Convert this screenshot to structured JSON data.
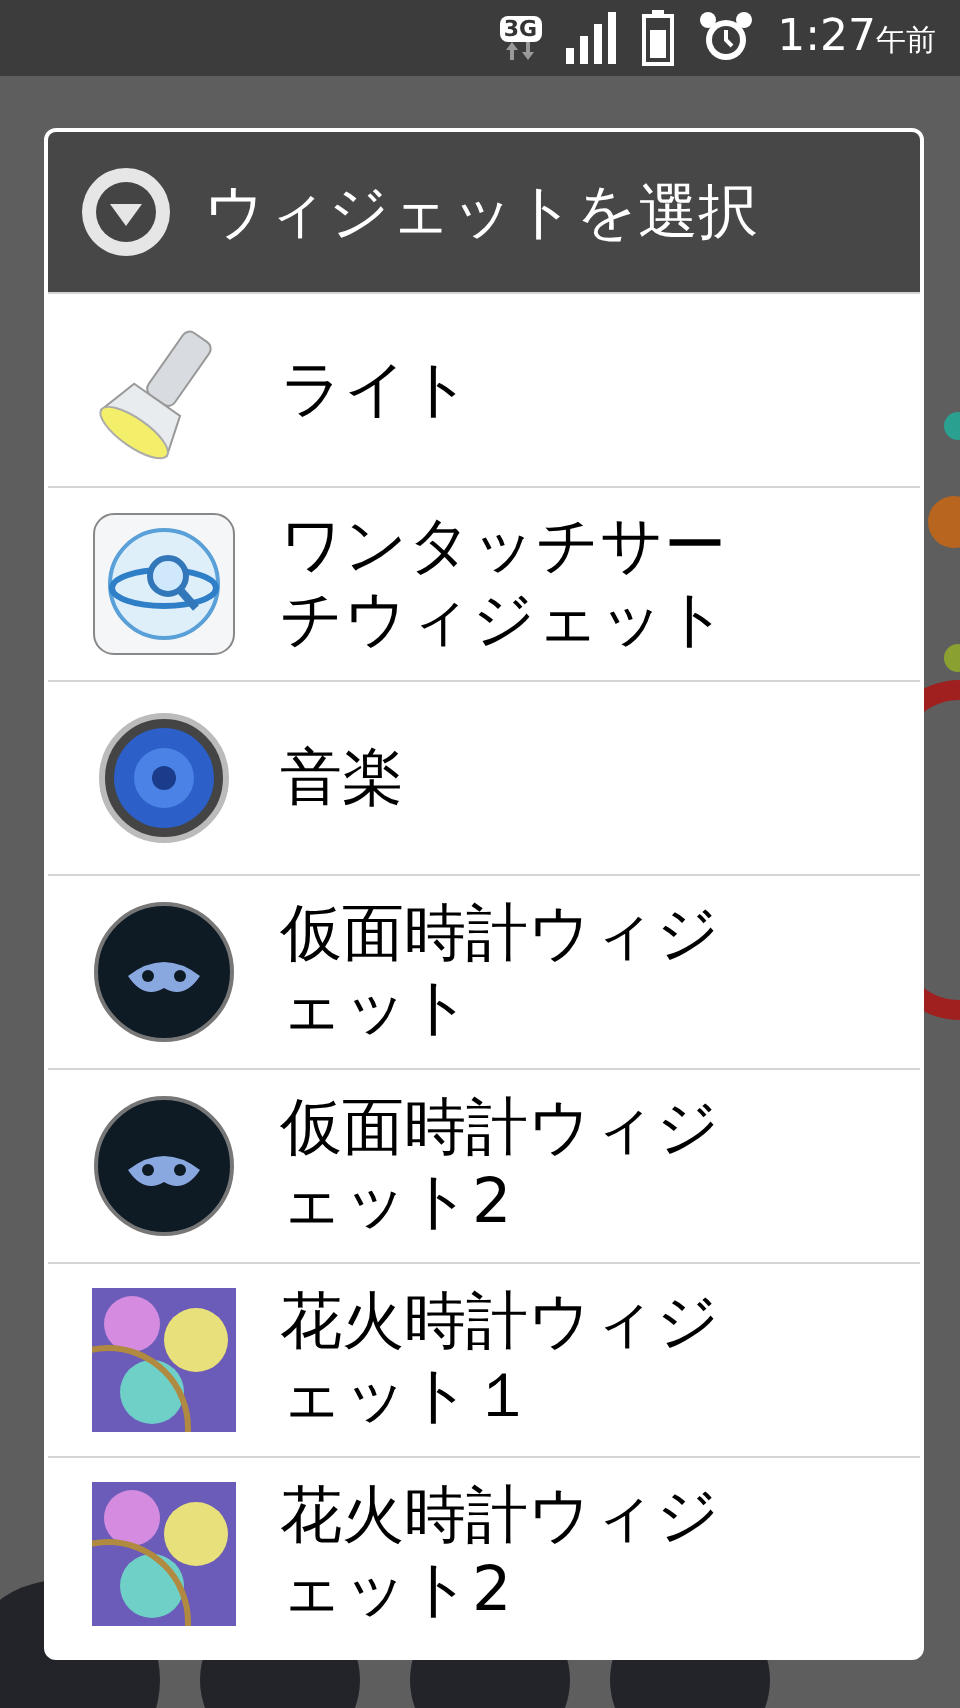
{
  "status_bar": {
    "network": "3G",
    "time": "1:27",
    "ampm": "午前"
  },
  "dialog": {
    "title": "ウィジェットを選択",
    "items": [
      {
        "kind": "flashlight",
        "label": "ライト"
      },
      {
        "kind": "search",
        "label": "ワンタッチサーチウィジェット"
      },
      {
        "kind": "speaker",
        "label": "音楽"
      },
      {
        "kind": "mask",
        "label": "仮面時計ウィジェット"
      },
      {
        "kind": "mask",
        "label": "仮面時計ウィジェット2"
      },
      {
        "kind": "fireworks",
        "label": "花火時計ウィジェット１"
      },
      {
        "kind": "fireworks",
        "label": "花火時計ウィジェット2"
      }
    ]
  }
}
